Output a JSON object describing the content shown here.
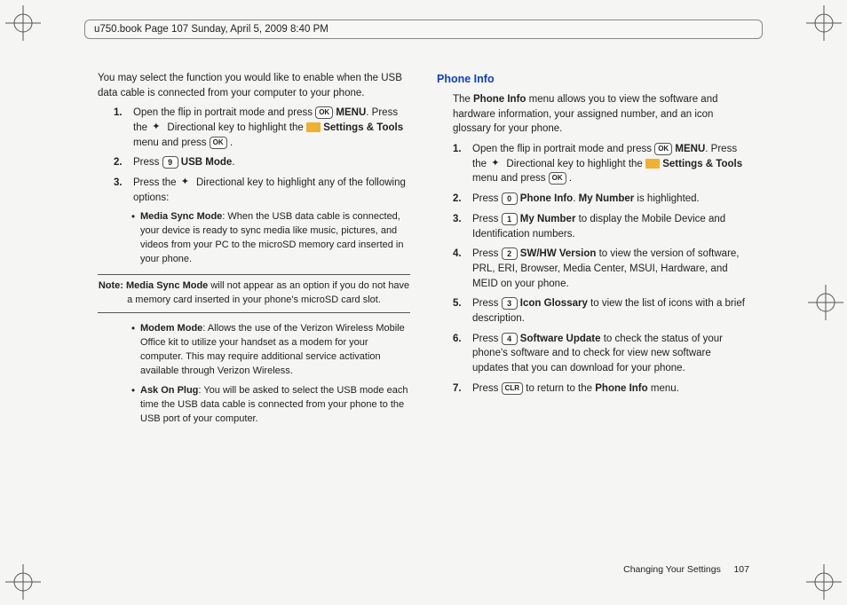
{
  "header": "u750.book  Page 107  Sunday, April 5, 2009  8:40 PM",
  "left": {
    "intro": "You may select the function you would like to enable when the USB data cable is connected from your computer to your phone.",
    "s1a": "Open the flip in portrait mode and press ",
    "menu": "MENU",
    "s1b": ". Press the ",
    "s1c": " Directional key to highlight the ",
    "settings": "Settings & Tools",
    "s1d": " menu and press ",
    "s2a": "Press ",
    "usb": "USB Mode",
    "s3a": "Press the ",
    "s3b": " Directional key to highlight any of the following options:",
    "b1t": "Media Sync Mode",
    "b1": ":  When the USB data cable is connected, your device is ready to sync media like music, pictures, and videos from your PC to the microSD memory card inserted in your phone.",
    "noteLabel": "Note: Media Sync Mode",
    "note": " will not appear as an option if you do not have a memory card inserted in your phone's microSD card slot.",
    "b2t": "Modem Mode",
    "b2": ": Allows the use of the Verizon Wireless Mobile Office kit to utilize your handset as a modem for your computer. This may require additional service activation available through Verizon Wireless.",
    "b3t": "Ask On Plug",
    "b3": ": You will be asked to select the USB mode each time the USB data cable is connected from your phone to the USB port of your computer."
  },
  "right": {
    "title": "Phone Info",
    "intro1": "The ",
    "phoneInfo": "Phone Info",
    "intro2": " menu allows you to view the software and hardware information, your assigned number, and an icon glossary for your phone.",
    "s1a": "Open the flip in portrait mode and press ",
    "menu": "MENU",
    "s1b": ". Press the ",
    "s1c": " Directional key to highlight the ",
    "settings": "Settings & Tools",
    "s1d": " menu and press ",
    "s2a": "Press ",
    "s2b": ". ",
    "myNum": "My Number",
    "s2c": " is highlighted.",
    "s3a": "Press ",
    "s3b": " to display the Mobile Device and Identification numbers.",
    "s4a": "Press ",
    "swhw": "SW/HW Version",
    "s4b": " to view the version of software, PRL, ERI, Browser, Media Center, MSUI, Hardware, and MEID on your phone.",
    "s5a": "Press ",
    "icong": "Icon Glossary",
    "s5b": " to view the list of icons with a brief description.",
    "s6a": "Press ",
    "swu": "Software Update",
    "s6b": " to check the status of your phone's software and to check for view new software updates that you can download for your phone.",
    "s7a": "Press ",
    "s7b": " to return to the ",
    "s7c": " menu."
  },
  "keys": {
    "ok": "OK",
    "clr": "CLR",
    "k9": "9",
    "k0": "0",
    "k1": "1",
    "k2": "2",
    "k3": "3",
    "k4": "4"
  },
  "footer": {
    "section": "Changing Your Settings",
    "page": "107"
  }
}
